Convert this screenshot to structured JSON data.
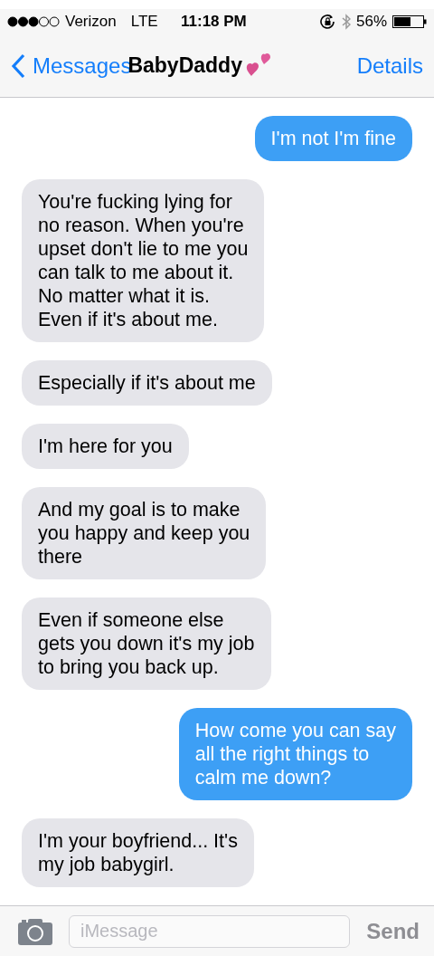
{
  "status_bar": {
    "carrier": "Verizon",
    "network": "LTE",
    "time": "11:18 PM",
    "battery": "56%"
  },
  "nav": {
    "back": "Messages",
    "title": "BabyDaddy",
    "action": "Details"
  },
  "messages": [
    {
      "kind": "sent",
      "text": "I'm not I'm fine"
    },
    {
      "kind": "received",
      "text": "You're fucking lying for\nno reason. When you're\nupset don't lie to me you\ncan talk to me about it.\nNo matter what it is.\nEven if it's about me."
    },
    {
      "kind": "received",
      "text": "Especially if it's about me"
    },
    {
      "kind": "received",
      "text": "I'm here for you"
    },
    {
      "kind": "received",
      "text": "And my goal is to make\nyou happy and keep you\nthere"
    },
    {
      "kind": "received",
      "text": "Even if someone else\ngets you down it's my job\nto bring you back up."
    },
    {
      "kind": "sent",
      "text": "How come you can say\nall the right things to\ncalm me down?"
    },
    {
      "kind": "received",
      "text": "I'm your boyfriend... It's\nmy job babygirl."
    }
  ],
  "composer": {
    "placeholder": "iMessage",
    "send": {
      "label": "Send",
      "disabled": true
    }
  }
}
